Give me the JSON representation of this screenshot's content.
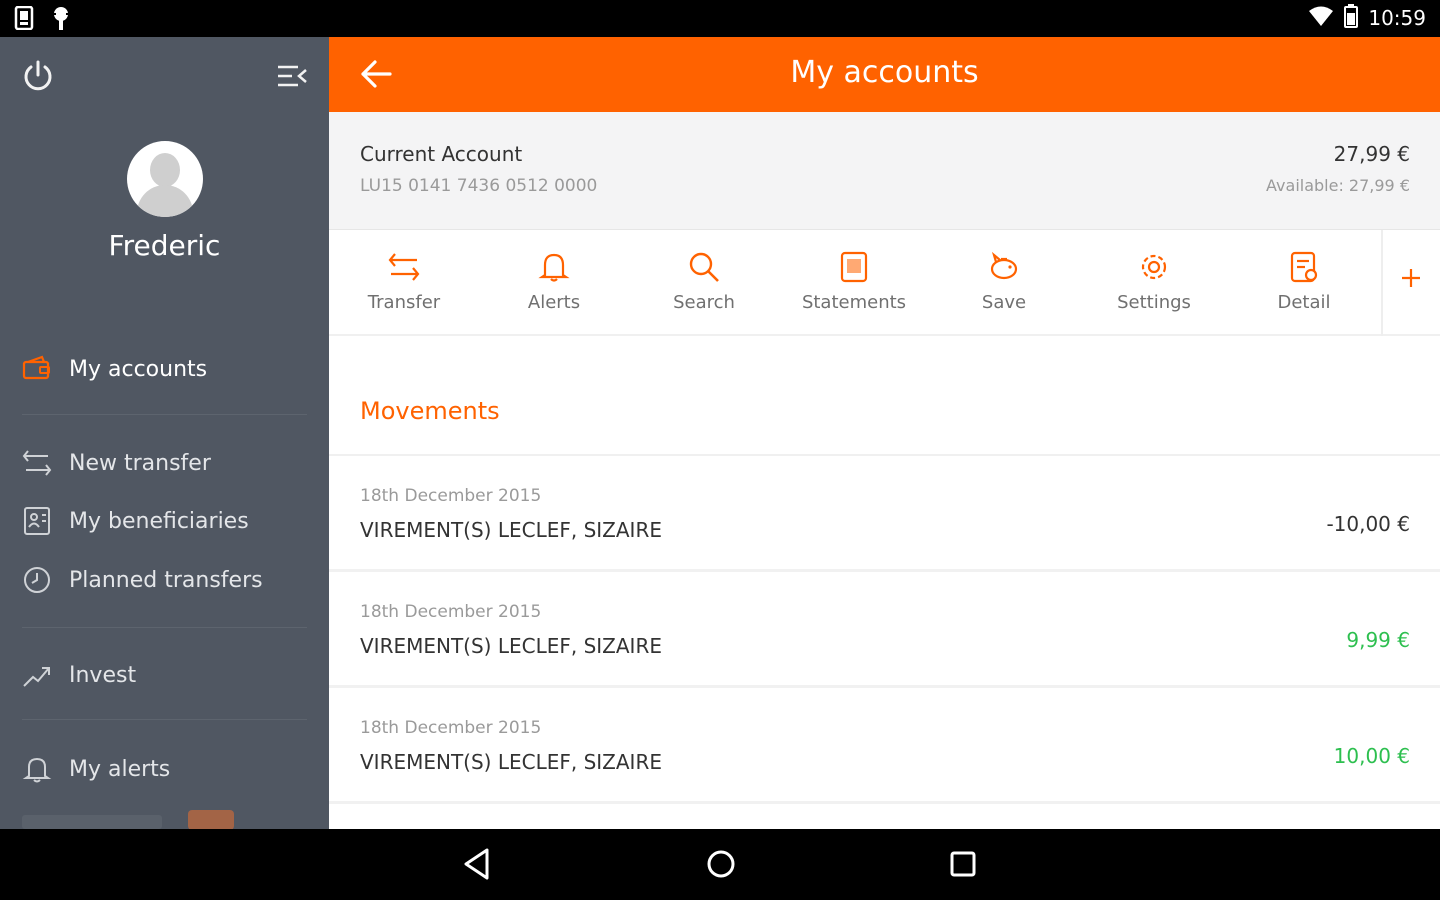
{
  "status_bar": {
    "time": "10:59",
    "icons": [
      "sim-card-icon",
      "usb-debug-icon",
      "wifi-icon",
      "battery-icon"
    ]
  },
  "sidebar": {
    "user_name": "Frederic",
    "items": [
      {
        "label": "My accounts",
        "icon": "wallet-icon",
        "active": true
      },
      {
        "label": "New transfer",
        "icon": "transfer-icon"
      },
      {
        "label": "My beneficiaries",
        "icon": "contacts-icon"
      },
      {
        "label": "Planned transfers",
        "icon": "clock-icon"
      },
      {
        "label": "Invest",
        "icon": "trend-icon"
      },
      {
        "label": "My alerts",
        "icon": "bell-icon"
      }
    ]
  },
  "header": {
    "title": "My accounts"
  },
  "account": {
    "name": "Current Account",
    "iban": "LU15 0141 7436 0512 0000",
    "balance": "27,99 €",
    "available": "Available: 27,99 €"
  },
  "actions": [
    {
      "label": "Transfer",
      "icon": "transfer-icon"
    },
    {
      "label": "Alerts",
      "icon": "bell-icon"
    },
    {
      "label": "Search",
      "icon": "search-icon"
    },
    {
      "label": "Statements",
      "icon": "document-icon"
    },
    {
      "label": "Save",
      "icon": "piggy-bank-icon"
    },
    {
      "label": "Settings",
      "icon": "gear-icon"
    },
    {
      "label": "Detail",
      "icon": "detail-icon"
    }
  ],
  "movements": {
    "title": "Movements",
    "items": [
      {
        "date": "18th December 2015",
        "description": "VIREMENT(S) LECLEF, SIZAIRE",
        "amount": "-10,00 €",
        "type": "debit"
      },
      {
        "date": "18th December 2015",
        "description": "VIREMENT(S) LECLEF, SIZAIRE",
        "amount": "9,99 €",
        "type": "credit"
      },
      {
        "date": "18th December 2015",
        "description": "VIREMENT(S) LECLEF, SIZAIRE",
        "amount": "10,00 €",
        "type": "credit"
      }
    ]
  },
  "colors": {
    "accent": "#ff6200",
    "sidebar_bg": "#505762",
    "credit": "#2dbf4f",
    "debit": "#333333"
  }
}
